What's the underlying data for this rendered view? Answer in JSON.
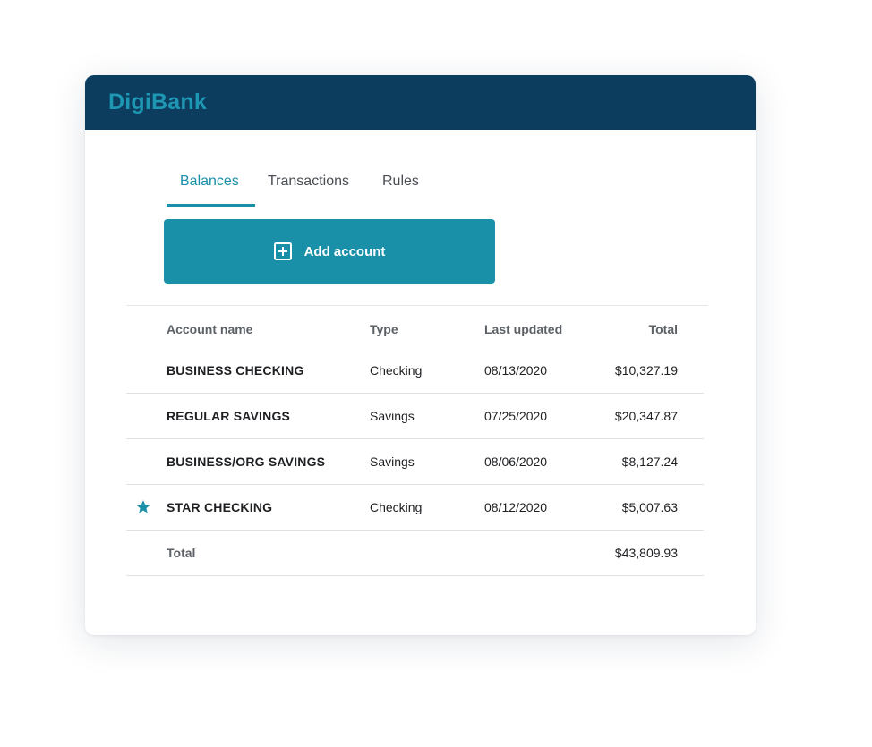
{
  "app": {
    "brand": "DigiBank"
  },
  "tabs": [
    {
      "label": "Balances",
      "active": true
    },
    {
      "label": "Transactions",
      "active": false
    },
    {
      "label": "Rules",
      "active": false
    }
  ],
  "actions": {
    "add_account_label": "Add account",
    "add_account_icon": "plus-square-icon"
  },
  "table": {
    "columns": {
      "name": "Account name",
      "type": "Type",
      "updated": "Last updated",
      "total": "Total"
    },
    "rows": [
      {
        "name": "BUSINESS CHECKING",
        "type": "Checking",
        "updated": "08/13/2020",
        "total": "$10,327.19",
        "starred": false
      },
      {
        "name": "REGULAR SAVINGS",
        "type": "Savings",
        "updated": "07/25/2020",
        "total": "$20,347.87",
        "starred": false
      },
      {
        "name": "BUSINESS/ORG SAVINGS",
        "type": "Savings",
        "updated": "08/06/2020",
        "total": "$8,127.24",
        "starred": false
      },
      {
        "name": "STAR CHECKING",
        "type": "Checking",
        "updated": "08/12/2020",
        "total": "$5,007.63",
        "starred": true
      }
    ],
    "total_row": {
      "label": "Total",
      "value": "$43,809.93"
    }
  },
  "colors": {
    "header_bg": "#0c3c5e",
    "brand_accent": "#1a8fa8",
    "logo": "#1d97b2"
  }
}
